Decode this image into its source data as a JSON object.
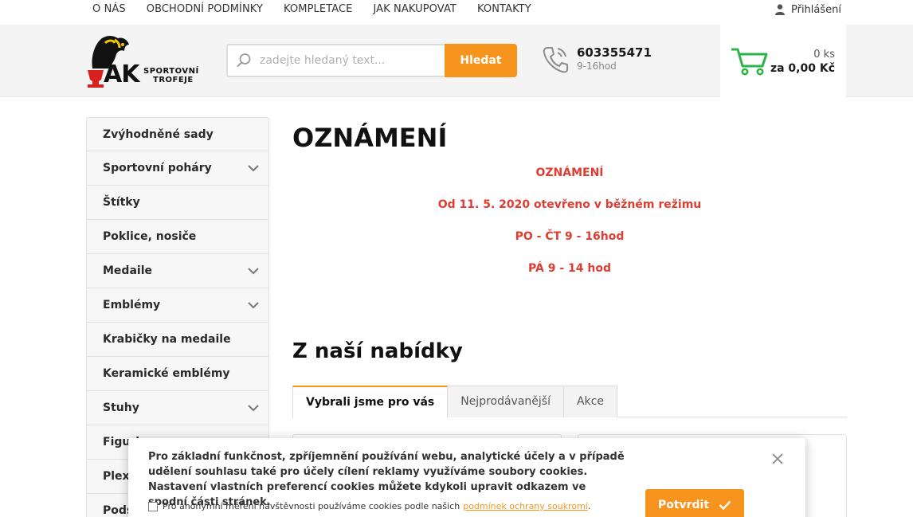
{
  "topnav": {
    "items": [
      {
        "label": "O NÁS"
      },
      {
        "label": "OBCHODNÍ PODMÍNKY"
      },
      {
        "label": "KOMPLETACE"
      },
      {
        "label": "JAK NAKUPOVAT"
      },
      {
        "label": "KONTAKTY"
      }
    ],
    "login_label": "Přihlášení",
    "login_icon": "user-icon"
  },
  "header": {
    "logo": {
      "main_text": "AK",
      "line1": "SPORTOVNÍ",
      "line2": "TROFEJE"
    },
    "search": {
      "placeholder": "zadejte hledaný text...",
      "value": "",
      "button_label": "Hledat",
      "icon": "search-icon"
    },
    "phone": {
      "number": "603355471",
      "hours": "9-16hod",
      "icon": "phone-icon"
    },
    "cart": {
      "quantity": "0 ks",
      "total": "za 0,00 Kč",
      "icon": "cart-icon"
    }
  },
  "sidebar": {
    "items": [
      {
        "label": "Zvýhodněné sady",
        "has_children": false
      },
      {
        "label": "Sportovní poháry",
        "has_children": true
      },
      {
        "label": "Štítky",
        "has_children": false
      },
      {
        "label": "Poklice, nosiče",
        "has_children": false
      },
      {
        "label": "Medaile",
        "has_children": true
      },
      {
        "label": "Emblémy",
        "has_children": true
      },
      {
        "label": "Krabičky na medaile",
        "has_children": false
      },
      {
        "label": "Keramické emblémy",
        "has_children": false
      },
      {
        "label": "Stuhy",
        "has_children": true
      },
      {
        "label": "Figurky",
        "has_children": false
      },
      {
        "label": "Plexi",
        "has_children": false
      },
      {
        "label": "Podstavce",
        "has_children": false
      }
    ]
  },
  "main": {
    "title": "OZNÁMENÍ",
    "notice": [
      "OZNÁMENÍ",
      "Od 11. 5. 2020 otevřeno v běžném režimu",
      "PO - ČT 9 - 16hod",
      "PÁ 9 - 14 hod"
    ],
    "offer_title": "Z naší nabídky",
    "tabs": [
      {
        "label": "Vybrali jsme pro vás",
        "active": true
      },
      {
        "label": "Nejprodávanější",
        "active": false
      },
      {
        "label": "Akce",
        "active": false
      }
    ]
  },
  "cookie": {
    "text": "Pro základní funkčnost, zpříjemnění používání webu, analytické účely a v případě udělení souhlasu také pro účely cílení reklamy využíváme soubory cookies. Nastavení vlastních preferencí cookies můžete kdykoli upravit odkazem ve spodní části stránek.",
    "checkbox_label": "Pro anonymní měření návštěvnosti používáme cookies podle našich",
    "checkbox_link": "podmínek ochrany soukromí",
    "checkbox_suffix": ".",
    "confirm_label": "Potvrdit"
  },
  "colors": {
    "accent": "#f7941d",
    "notice_red": "#e03c31",
    "cart_green": "#2db34a"
  }
}
